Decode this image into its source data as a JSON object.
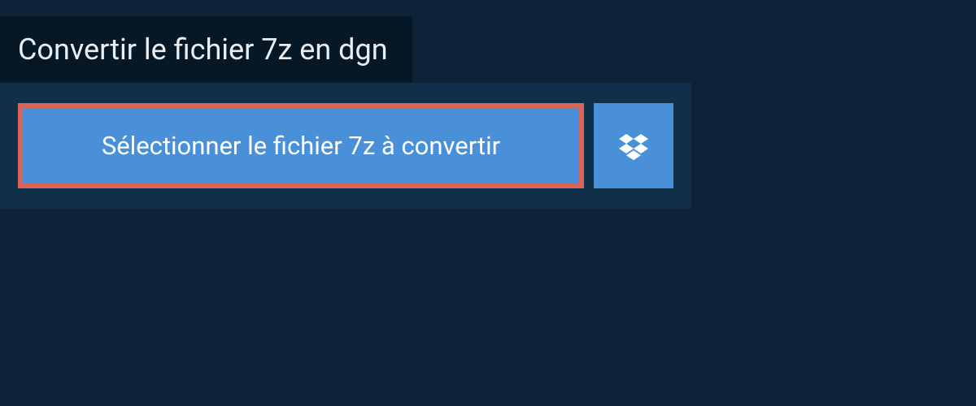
{
  "header": {
    "title": "Convertir le fichier 7z en dgn"
  },
  "upload": {
    "select_button_label": "Sélectionner le fichier 7z à convertir",
    "dropbox_icon_name": "dropbox-icon"
  },
  "colors": {
    "page_bg": "#0d2438",
    "tab_bg": "#061725",
    "panel_bg": "#102f49",
    "button_bg": "#4a90d9",
    "highlight_border": "#d96459",
    "text_light": "#e8eef2",
    "text_white": "#ffffff"
  }
}
